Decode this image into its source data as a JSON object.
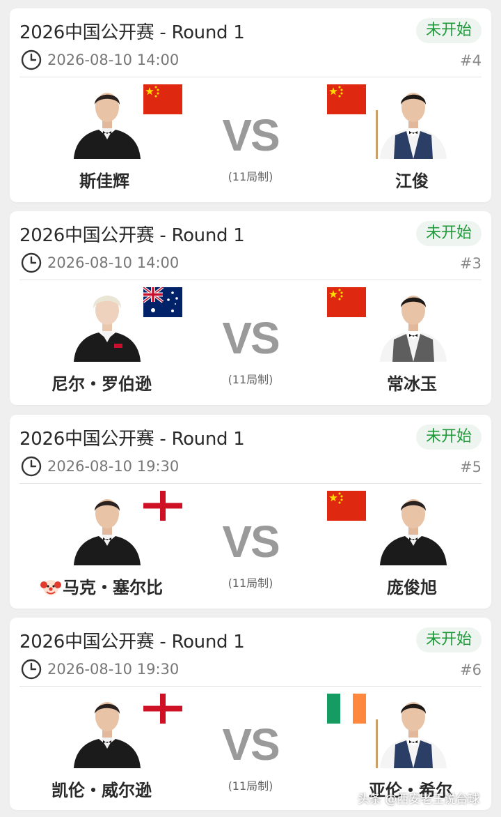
{
  "matches": [
    {
      "title": "2026中国公开赛 - Round 1",
      "status": "未开始",
      "datetime": "2026-08-10 14:00",
      "match_number": "#4",
      "format": "(11局制)",
      "vs": "VS",
      "left": {
        "name": "斯佳辉",
        "flag": "china-flag",
        "prefix": ""
      },
      "right": {
        "name": "江俊",
        "flag": "china-flag"
      }
    },
    {
      "title": "2026中国公开赛 - Round 1",
      "status": "未开始",
      "datetime": "2026-08-10 14:00",
      "match_number": "#3",
      "format": "(11局制)",
      "vs": "VS",
      "left": {
        "name": "尼尔・罗伯逊",
        "flag": "australia-flag",
        "prefix": ""
      },
      "right": {
        "name": "常冰玉",
        "flag": "china-flag"
      }
    },
    {
      "title": "2026中国公开赛 - Round 1",
      "status": "未开始",
      "datetime": "2026-08-10 19:30",
      "match_number": "#5",
      "format": "(11局制)",
      "vs": "VS",
      "left": {
        "name": "马克・塞尔比",
        "flag": "england-flag",
        "prefix": "clown-emoji"
      },
      "right": {
        "name": "庞俊旭",
        "flag": "china-flag"
      }
    },
    {
      "title": "2026中国公开赛 - Round 1",
      "status": "未开始",
      "datetime": "2026-08-10 19:30",
      "match_number": "#6",
      "format": "(11局制)",
      "vs": "VS",
      "left": {
        "name": "凯伦・威尔逊",
        "flag": "england-flag",
        "prefix": ""
      },
      "right": {
        "name": "亚伦・希尔",
        "flag": "ireland-flag"
      }
    }
  ],
  "watermark": "头条 @西安老王说台球",
  "colors": {
    "status_green": "#1f9a3a",
    "badge_bg": "#eef4ef",
    "vs_gray": "#9a9a9a"
  }
}
